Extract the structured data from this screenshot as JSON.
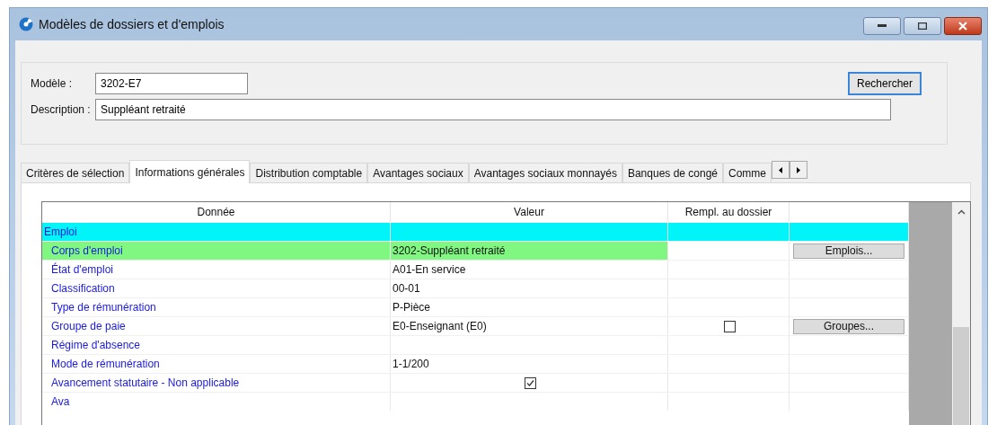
{
  "window": {
    "title": "Modèles de dossiers et d'emplois"
  },
  "form": {
    "model_label": "Modèle :",
    "model_value": "3202-E7",
    "description_label": "Description :",
    "description_value": "Suppléant retraité",
    "search_button": "Rechercher"
  },
  "tabs": [
    {
      "label": "Critères de sélection",
      "selected": false
    },
    {
      "label": "Informations générales",
      "selected": true
    },
    {
      "label": "Distribution comptable",
      "selected": false
    },
    {
      "label": "Avantages sociaux",
      "selected": false
    },
    {
      "label": "Avantages sociaux monnayés",
      "selected": false
    },
    {
      "label": "Banques de congé",
      "selected": false
    },
    {
      "label": "Comme",
      "selected": false
    }
  ],
  "table": {
    "columns": [
      "Donnée",
      "Valeur",
      "Rempl. au dossier"
    ],
    "rows": [
      {
        "kind": "group",
        "label": "Emploi"
      },
      {
        "kind": "field",
        "label": "Corps d'emploi",
        "value": "3202-Suppléant retraité",
        "button": "Emplois...",
        "selected": true
      },
      {
        "kind": "field",
        "label": "État d'emploi",
        "value": "A01-En service",
        "selected": false
      },
      {
        "kind": "field",
        "label": "Classification",
        "value": "00-01",
        "selected": false
      },
      {
        "kind": "field",
        "label": "Type de rémunération",
        "value": "P-Pièce",
        "selected": false
      },
      {
        "kind": "field",
        "label": "Groupe de paie",
        "value": "E0-Enseignant (E0)",
        "rempl_checked": false,
        "button": "Groupes...",
        "selected": false
      },
      {
        "kind": "field",
        "label": "Régime d'absence",
        "selected": false
      },
      {
        "kind": "field",
        "label": "Mode de rémunération",
        "value": "1-1/200",
        "selected": false
      },
      {
        "kind": "field",
        "label": "Avancement statutaire - Non applicable",
        "value_checked": true,
        "selected": false
      },
      {
        "kind": "field",
        "label": "Ava",
        "selected": false
      }
    ]
  }
}
